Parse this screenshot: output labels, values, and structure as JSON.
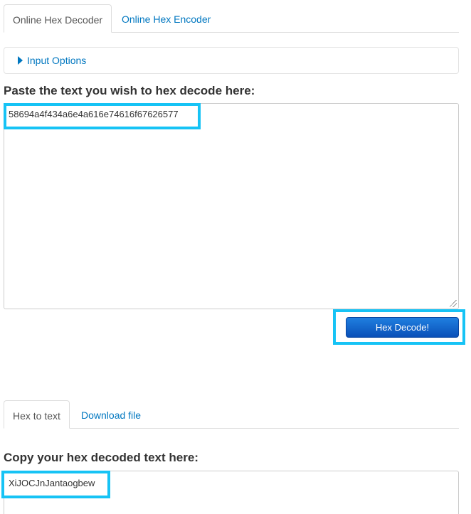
{
  "top_tabs": [
    {
      "label": "Online Hex Decoder",
      "active": true
    },
    {
      "label": "Online Hex Encoder",
      "active": false
    }
  ],
  "input_options": {
    "label": "Input Options"
  },
  "input_section": {
    "heading": "Paste the text you wish to hex decode here:",
    "value": "58694a4f434a6e4a616e74616f67626577"
  },
  "decode_button": {
    "label": "Hex Decode!"
  },
  "bottom_tabs": [
    {
      "label": "Hex to text",
      "active": true
    },
    {
      "label": "Download file",
      "active": false
    }
  ],
  "output_section": {
    "heading": "Copy your hex decoded text here:",
    "value": "XiJOCJnJantaogbew"
  },
  "colors": {
    "link": "#0077c0",
    "highlight": "#16c3f5",
    "button": "#0a50b8"
  }
}
